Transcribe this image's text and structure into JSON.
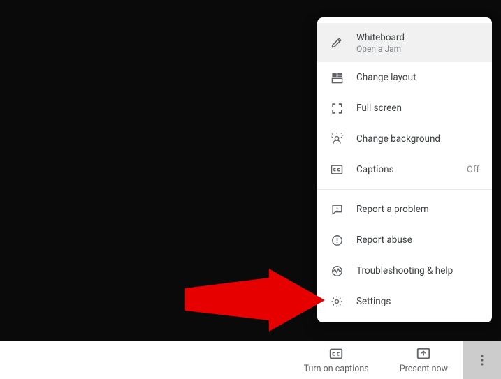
{
  "menu": {
    "whiteboard": {
      "label": "Whiteboard",
      "sub": "Open a Jam"
    },
    "change_layout": "Change layout",
    "full_screen": "Full screen",
    "change_background": "Change background",
    "captions": {
      "label": "Captions",
      "status": "Off"
    },
    "report_problem": "Report a problem",
    "report_abuse": "Report abuse",
    "troubleshooting": "Troubleshooting & help",
    "settings": "Settings"
  },
  "bottom": {
    "captions": "Turn on captions",
    "present": "Present now"
  }
}
